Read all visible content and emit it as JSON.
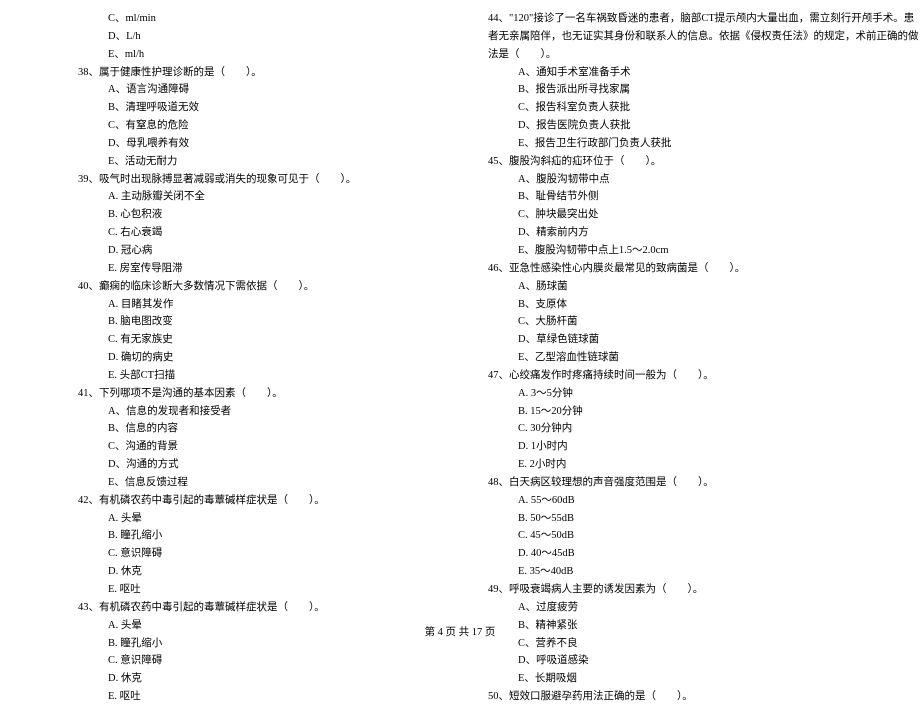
{
  "left_col": {
    "opt_c_37": "C、ml/min",
    "opt_d_37": "D、L/h",
    "opt_e_37": "E、ml/h",
    "q38": "38、属于健康性护理诊断的是（　　）。",
    "q38_a": "A、语言沟通障碍",
    "q38_b": "B、清理呼吸道无效",
    "q38_c": "C、有窒息的危险",
    "q38_d": "D、母乳喂养有效",
    "q38_e": "E、活动无耐力",
    "q39": "39、吸气时出现脉搏显著减弱或消失的现象可见于（　　）。",
    "q39_a": "A. 主动脉瓣关闭不全",
    "q39_b": "B. 心包积液",
    "q39_c": "C. 右心衰竭",
    "q39_d": "D. 冠心病",
    "q39_e": "E. 房室传导阻滞",
    "q40": "40、癫痫的临床诊断大多数情况下需依据（　　）。",
    "q40_a": "A. 目睹其发作",
    "q40_b": "B. 脑电图改变",
    "q40_c": "C. 有无家族史",
    "q40_d": "D. 确切的病史",
    "q40_e": "E. 头部CT扫描",
    "q41": "41、下列哪项不是沟通的基本因素（　　）。",
    "q41_a": "A、信息的发现者和接受者",
    "q41_b": "B、信息的内容",
    "q41_c": "C、沟通的背景",
    "q41_d": "D、沟通的方式",
    "q41_e": "E、信息反馈过程",
    "q42": "42、有机磷农药中毒引起的毒蕈碱样症状是（　　）。",
    "q42_a": "A. 头晕",
    "q42_b": "B. 瞳孔缩小",
    "q42_c": "C. 意识障碍",
    "q42_d": "D. 休克",
    "q42_e": "E. 呕吐",
    "q43": "43、有机磷农药中毒引起的毒蕈碱样症状是（　　）。",
    "q43_a": "A. 头晕",
    "q43_b": "B. 瞳孔缩小",
    "q43_c": "C. 意识障碍",
    "q43_d": "D. 休克",
    "q43_e": "E. 呕吐"
  },
  "right_col": {
    "q44_l1": "44、\"120\"接诊了一名车祸致昏迷的患者，脑部CT提示颅内大量出血，需立刻行开颅手术。患",
    "q44_l2": "者无亲属陪伴，也无证实其身份和联系人的信息。依据《侵权责任法》的规定，术前正确的做",
    "q44_l3": "法是（　　）。",
    "q44_a": "A、通知手术室准备手术",
    "q44_b": "B、报告派出所寻找家属",
    "q44_c": "C、报告科室负责人获批",
    "q44_d": "D、报告医院负责人获批",
    "q44_e": "E、报告卫生行政部门负责人获批",
    "q45": "45、腹股沟斜疝的疝环位于（　　）。",
    "q45_a": "A、腹股沟韧带中点",
    "q45_b": "B、耻骨结节外侧",
    "q45_c": "C、肿块最突出处",
    "q45_d": "D、精索前内方",
    "q45_e": "E、腹股沟韧带中点上1.5～2.0cm",
    "q46": "46、亚急性感染性心内膜炎最常见的致病菌是（　　）。",
    "q46_a": "A、肠球菌",
    "q46_b": "B、支原体",
    "q46_c": "C、大肠杆菌",
    "q46_d": "D、草绿色链球菌",
    "q46_e": "E、乙型溶血性链球菌",
    "q47": "47、心绞痛发作时疼痛持续时间一般为（　　）。",
    "q47_a": "A. 3～5分钟",
    "q47_b": "B. 15～20分钟",
    "q47_c": "C. 30分钟内",
    "q47_d": "D. 1小时内",
    "q47_e": "E. 2小时内",
    "q48": "48、白天病区较理想的声音强度范围是（　　）。",
    "q48_a": "A. 55～60dB",
    "q48_b": "B. 50～55dB",
    "q48_c": "C. 45～50dB",
    "q48_d": "D. 40～45dB",
    "q48_e": "E. 35～40dB",
    "q49": "49、呼吸衰竭病人主要的诱发因素为（　　）。",
    "q49_a": "A、过度疲劳",
    "q49_b": "B、精神紧张",
    "q49_c": "C、营养不良",
    "q49_d": "D、呼吸道感染",
    "q49_e": "E、长期吸烟",
    "q50": "50、短效口服避孕药用法正确的是（　　）。"
  },
  "footer": "第 4 页 共 17 页"
}
